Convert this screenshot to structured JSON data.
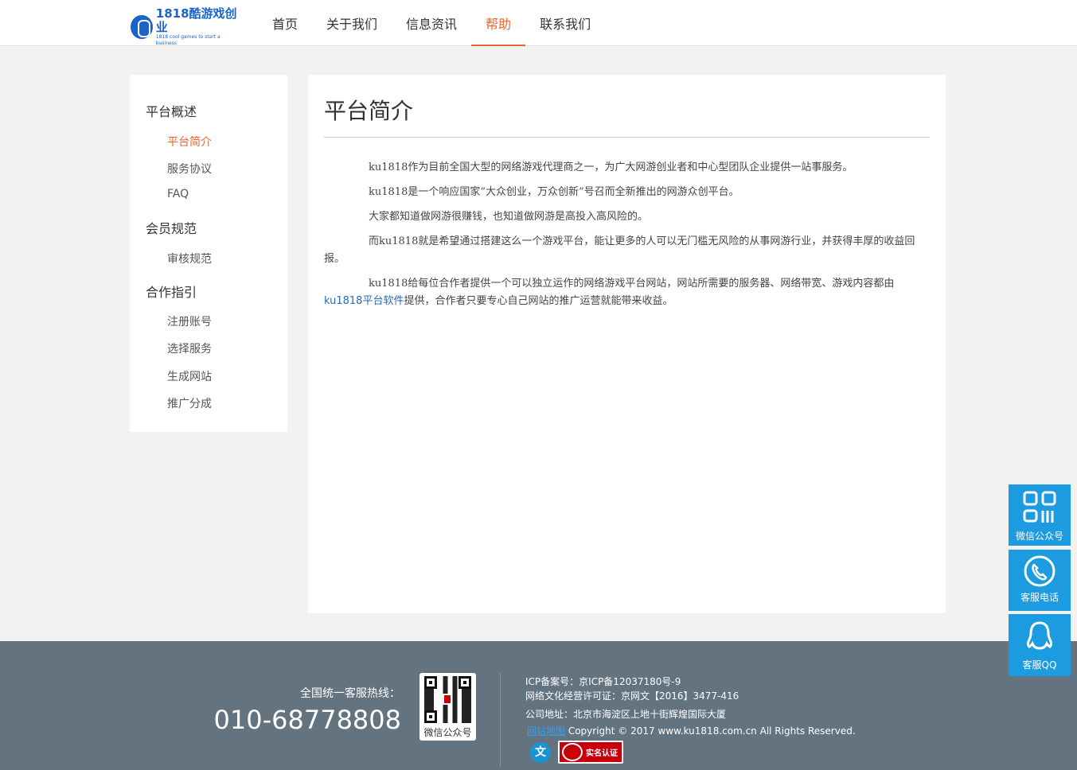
{
  "header": {
    "logo_main": "1818酷游戏创业",
    "logo_sub": "1818 cool games to start a business",
    "nav": [
      {
        "label": "首页",
        "active": false
      },
      {
        "label": "关于我们",
        "active": false
      },
      {
        "label": "信息资讯",
        "active": false
      },
      {
        "label": "帮助",
        "active": true
      },
      {
        "label": "联系我们",
        "active": false
      }
    ],
    "accent_color": "#e8662e"
  },
  "sidebar": {
    "groups": [
      {
        "label": "平台概述",
        "items": [
          "平台简介",
          "服务协议",
          "FAQ"
        ]
      },
      {
        "label": "会员规范",
        "items": [
          "审核规范"
        ]
      },
      {
        "label": "合作指引",
        "items": [
          "注册账号",
          "选择服务",
          "生成网站",
          "推广分成"
        ]
      }
    ],
    "active_item": "平台简介"
  },
  "main": {
    "title": "平台简介",
    "paragraphs": [
      "ku1818作为目前全国大型的网络游戏代理商之一，为广大网游创业者和中心型团队企业提供一站事服务。",
      "ku1818是一个响应国家“大众创业，万众创新”号召而全新推出的网游众创平台。",
      "大家都知道做网游很赚钱，也知道做网游是高投入高风险的。",
      "而ku1818就是希望通过搭建这么一个游戏平台，能让更多的人可以无门槛无风险的从事网游行业，并获得丰厚的收益回报。"
    ],
    "last_paragraph_start": "ku1818给每位合作者提供一个可以独立运作的网络游戏平台网站，网站所需要的服务器、网络带宽、游戏内容都由",
    "last_paragraph_link": "ku1818平台软件",
    "last_paragraph_end": "提供，合作者只要专心自己网站的推广运营就能带来收益。"
  },
  "footer": {
    "hotline_label": "全国统一客服热线：",
    "hotline_number": "010-68778808",
    "qr_label": "微信公众号",
    "icp": "ICP备案号：京ICP备12037180号-9",
    "culture_license": "网络文化经营许可证：京网文【2016】3477-416",
    "address": "公司地址：北京市海淀区上地十街辉煌国际大厦",
    "sitemap_link": "网站地图",
    "copyright": " Copyright © 2017 www.ku1818.com.cn All Rights Reserved.",
    "badge_a_text": "文",
    "badge_b_text": "实名认证",
    "background_color": "#637380"
  },
  "floating": [
    {
      "label": "微信公众号",
      "icon": "qr-code-icon"
    },
    {
      "label": "客服电话",
      "icon": "phone-icon"
    },
    {
      "label": "客服QQ",
      "icon": "qq-icon"
    }
  ]
}
